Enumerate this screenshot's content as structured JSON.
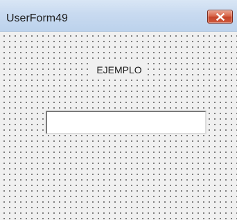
{
  "window": {
    "title": "UserForm49",
    "close_icon": "close-icon"
  },
  "form": {
    "label_text": "EJEMPLO",
    "textbox_value": "",
    "textbox_placeholder": ""
  },
  "colors": {
    "titlebar": "#c8daf0",
    "close_button": "#d8664a",
    "form_background": "#f0f0f0",
    "grid_dot": "#5e5e5e"
  }
}
